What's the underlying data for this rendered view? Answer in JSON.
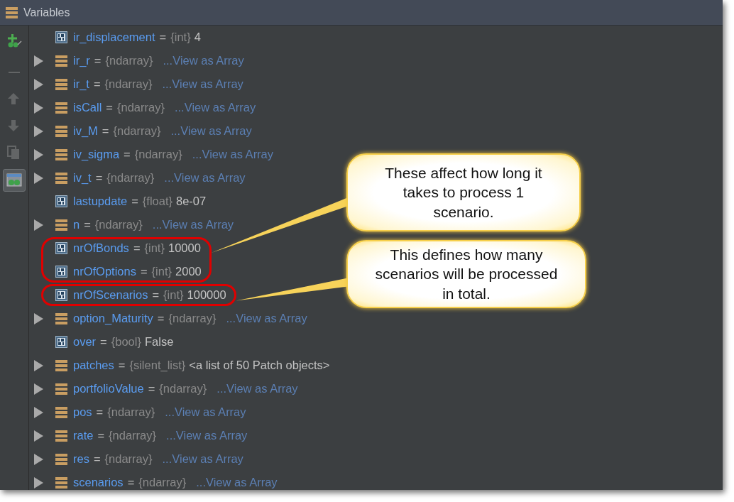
{
  "panel": {
    "title": "Variables"
  },
  "tools": [
    {
      "kind": "add-watch",
      "disabled": false,
      "selected": false
    },
    {
      "kind": "remove",
      "disabled": true,
      "selected": false
    },
    {
      "kind": "up",
      "disabled": true,
      "selected": false
    },
    {
      "kind": "down",
      "disabled": true,
      "selected": false
    },
    {
      "kind": "copy",
      "disabled": true,
      "selected": false
    },
    {
      "kind": "watches",
      "disabled": false,
      "selected": true
    }
  ],
  "variables": [
    {
      "kind": "scalar",
      "expandable": false,
      "name": "ir_displacement",
      "equals": "=",
      "type": "{int}",
      "value": "4",
      "circled": false
    },
    {
      "kind": "array",
      "expandable": true,
      "name": "ir_r",
      "equals": "=",
      "type": "{ndarray}",
      "link": "...View as Array",
      "circled": false
    },
    {
      "kind": "array",
      "expandable": true,
      "name": "ir_t",
      "equals": "=",
      "type": "{ndarray}",
      "link": "...View as Array",
      "circled": false
    },
    {
      "kind": "array",
      "expandable": true,
      "name": "isCall",
      "equals": "=",
      "type": "{ndarray}",
      "link": "...View as Array",
      "circled": false
    },
    {
      "kind": "array",
      "expandable": true,
      "name": "iv_M",
      "equals": "=",
      "type": "{ndarray}",
      "link": "...View as Array",
      "circled": false
    },
    {
      "kind": "array",
      "expandable": true,
      "name": "iv_sigma",
      "equals": "=",
      "type": "{ndarray}",
      "link": "...View as Array",
      "circled": false
    },
    {
      "kind": "array",
      "expandable": true,
      "name": "iv_t",
      "equals": "=",
      "type": "{ndarray}",
      "link": "...View as Array",
      "circled": false
    },
    {
      "kind": "scalar",
      "expandable": false,
      "name": "lastupdate",
      "equals": "=",
      "type": "{float}",
      "value": "8e-07",
      "circled": false
    },
    {
      "kind": "array",
      "expandable": true,
      "name": "n",
      "equals": "=",
      "type": "{ndarray}",
      "link": "...View as Array",
      "circled": false
    },
    {
      "kind": "scalar",
      "expandable": false,
      "name": "nrOfBonds",
      "equals": "=",
      "type": "{int}",
      "value": "10000",
      "circled": true
    },
    {
      "kind": "scalar",
      "expandable": false,
      "name": "nrOfOptions",
      "equals": "=",
      "type": "{int}",
      "value": "2000",
      "circled": true
    },
    {
      "kind": "scalar",
      "expandable": false,
      "name": "nrOfScenarios",
      "equals": "=",
      "type": "{int}",
      "value": "100000",
      "circled": true,
      "new_group": true
    },
    {
      "kind": "array",
      "expandable": true,
      "name": "option_Maturity",
      "equals": "=",
      "type": "{ndarray}",
      "link": "...View as Array",
      "circled": false
    },
    {
      "kind": "scalar",
      "expandable": false,
      "name": "over",
      "equals": "=",
      "type": "{bool}",
      "value": "False",
      "circled": false
    },
    {
      "kind": "array",
      "expandable": true,
      "name": "patches",
      "equals": "=",
      "type": "{silent_list}",
      "value": "<a list of 50 Patch objects>",
      "circled": false
    },
    {
      "kind": "array",
      "expandable": true,
      "name": "portfolioValue",
      "equals": "=",
      "type": "{ndarray}",
      "link": "...View as Array",
      "circled": false
    },
    {
      "kind": "array",
      "expandable": true,
      "name": "pos",
      "equals": "=",
      "type": "{ndarray}",
      "link": "...View as Array",
      "circled": false
    },
    {
      "kind": "array",
      "expandable": true,
      "name": "rate",
      "equals": "=",
      "type": "{ndarray}",
      "link": "...View as Array",
      "circled": false
    },
    {
      "kind": "array",
      "expandable": true,
      "name": "res",
      "equals": "=",
      "type": "{ndarray}",
      "link": "...View as Array",
      "circled": false
    },
    {
      "kind": "array",
      "expandable": true,
      "name": "scenarios",
      "equals": "=",
      "type": "{ndarray}",
      "link": "...View as Array",
      "circled": false
    }
  ],
  "callouts": [
    {
      "text": "These affect how long it takes to process 1 scenario."
    },
    {
      "text": "This defines how many scenarios will be processed in total."
    }
  ]
}
